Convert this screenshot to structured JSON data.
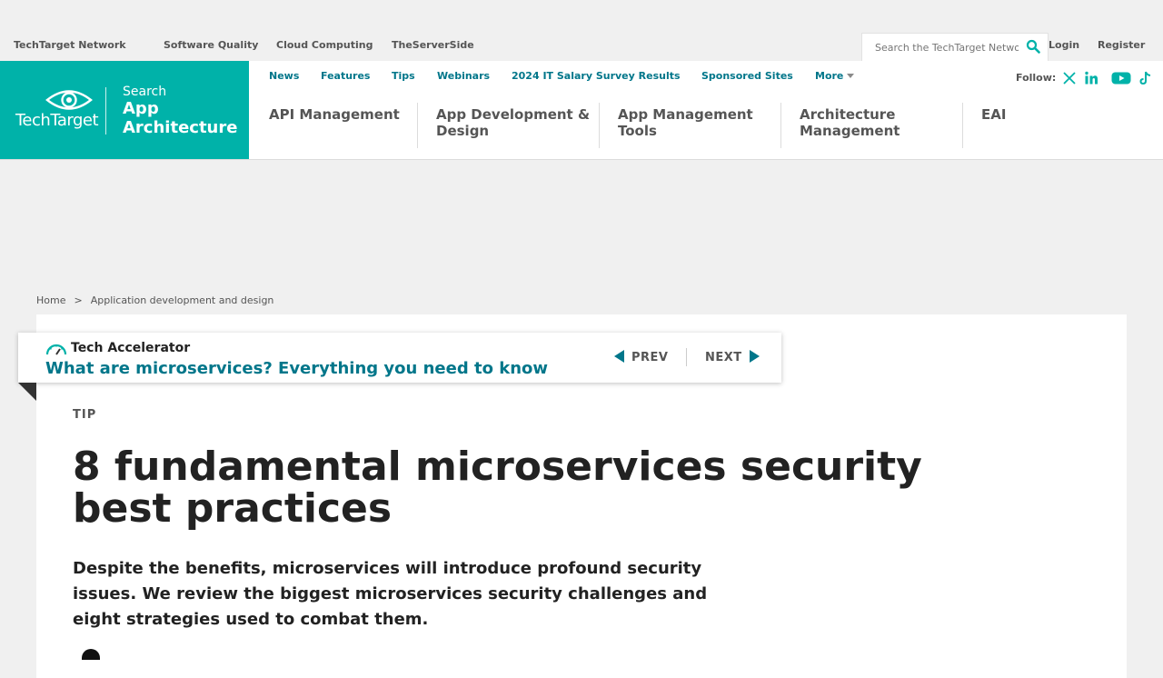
{
  "network": {
    "links": [
      "TechTarget Network",
      "Software Quality",
      "Cloud Computing",
      "TheServerSide"
    ],
    "search_placeholder": "Search the TechTarget Network",
    "login": "Login",
    "register": "Register"
  },
  "brand": {
    "logo_text": "TechTarget",
    "site_prefix": "Search",
    "site_name": "App Architecture",
    "color": "#00b2a9"
  },
  "topnav": {
    "items": [
      "News",
      "Features",
      "Tips",
      "Webinars",
      "2024 IT Salary Survey Results",
      "Sponsored Sites",
      "More"
    ],
    "follow_label": "Follow:",
    "social_icons": [
      "x-icon",
      "linkedin-icon",
      "youtube-icon",
      "tiktok-icon"
    ]
  },
  "topics": {
    "items": [
      "API Management",
      "App Development & Design",
      "App Management Tools",
      "Architecture Management",
      "EAI"
    ]
  },
  "breadcrumb": {
    "items": [
      "Home",
      "Application development and design"
    ],
    "separator": ">"
  },
  "accelerator": {
    "label": "Tech Accelerator",
    "title": "What are microservices? Everything you need to know",
    "prev": "PREV",
    "next": "NEXT"
  },
  "article": {
    "type": "TIP",
    "headline": "8 fundamental microservices security best practices",
    "dek": "Despite the benefits, microservices will introduce profound security issues. We review the biggest microservices security challenges and eight strategies used to combat them."
  },
  "colors": {
    "accent": "#00768a",
    "teal": "#00b2a9",
    "text": "#222222",
    "muted": "#555555"
  }
}
